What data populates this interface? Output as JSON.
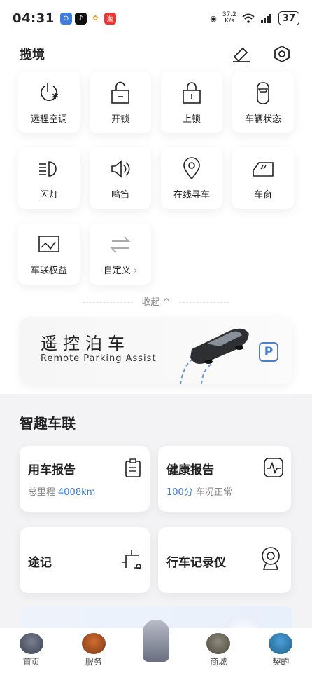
{
  "status": {
    "time": "04:31",
    "speed_top": "37.2",
    "speed_unit": "K/s",
    "battery": "37"
  },
  "header": {
    "title": "揽境"
  },
  "controls": [
    {
      "label": "远程空调",
      "icon": "snow-power-icon"
    },
    {
      "label": "开锁",
      "icon": "unlock-icon"
    },
    {
      "label": "上锁",
      "icon": "lock-icon"
    },
    {
      "label": "车辆状态",
      "icon": "car-top-icon"
    },
    {
      "label": "闪灯",
      "icon": "headlight-icon"
    },
    {
      "label": "鸣笛",
      "icon": "horn-icon"
    },
    {
      "label": "在线寻车",
      "icon": "location-pin-icon"
    },
    {
      "label": "车窗",
      "icon": "car-window-icon"
    },
    {
      "label": "车联权益",
      "icon": "benefits-icon"
    },
    {
      "label": "自定义",
      "icon": "swap-arrows-icon"
    }
  ],
  "collapse_label": "收起 ^",
  "parking": {
    "title_cn": "遥控泊车",
    "title_en": "Remote Parking Assist",
    "badge": "P"
  },
  "smart": {
    "title": "智趣车联",
    "cards": {
      "report": {
        "title": "用车报告",
        "sub_label": "总里程",
        "sub_value": "4008km"
      },
      "health": {
        "title": "健康报告",
        "sub_value": "100分",
        "sub_label": "车况正常"
      },
      "trip": {
        "title": "途记"
      },
      "recorder": {
        "title": "行车记录仪"
      }
    }
  },
  "nav": [
    {
      "label": "首页"
    },
    {
      "label": "服务"
    },
    {
      "label": ""
    },
    {
      "label": "商城"
    },
    {
      "label": "契的"
    }
  ],
  "colors": {
    "accent": "#3a7bd5",
    "background": "#f3f3f5"
  }
}
